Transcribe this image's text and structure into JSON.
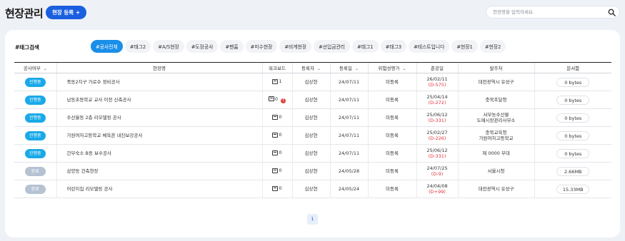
{
  "header": {
    "title": "현장관리",
    "register_label": "현장 등록 +",
    "search_placeholder": "현장명을 입력하세요."
  },
  "tags": {
    "label": "#태그검색",
    "items": [
      "#공사전체",
      "#태그2",
      "#A/S현장",
      "#도장공사",
      "#팬흄",
      "#미수현장",
      "#비계현장",
      "#선입금관리",
      "#태그1",
      "#태그3",
      "#테스트입니다",
      "#현장1",
      "#현장2"
    ],
    "active_index": 0
  },
  "table": {
    "headers": [
      "공사여부",
      "현장명",
      "워크보드",
      "등록자",
      "등록일",
      "위험성평가",
      "준공일",
      "발주처",
      "문서함"
    ],
    "rows": [
      {
        "status": "진행중",
        "status_type": "ongoing",
        "name": "죽동2지구 가로수 정비공사",
        "workboard": "1",
        "alert": "",
        "registrant": "김상현",
        "reg_date": "24/07/11",
        "risk": "미등록",
        "completion": "26/02/11",
        "dday": "(D-575)",
        "client": "대전광역시 유성구",
        "docs": "0 bytes"
      },
      {
        "status": "진행중",
        "status_type": "ongoing",
        "name": "남동초등학교 교사 이전 신축공사",
        "workboard": "0",
        "alert": "!",
        "registrant": "김상현",
        "reg_date": "24/07/11",
        "risk": "미등록",
        "completion": "25/04/14",
        "dday": "(D-272)",
        "client": "충북조달청",
        "docs": "0 bytes"
      },
      {
        "status": "진행중",
        "status_type": "ongoing",
        "name": "수산율동 2층 리모델링 공사",
        "workboard": "0",
        "alert": "",
        "registrant": "김상현",
        "reg_date": "24/07/11",
        "risk": "미등록",
        "completion": "25/06/12",
        "dday": "(D-331)",
        "client": "서부농수산물\n도매시장관리사무소",
        "docs": "0 bytes"
      },
      {
        "status": "진행중",
        "status_type": "ongoing",
        "name": "가원여자고등학교 체육관 내진보강공사",
        "workboard": "0",
        "alert": "",
        "registrant": "김상현",
        "reg_date": "24/07/11",
        "risk": "미등록",
        "completion": "25/02/27",
        "dday": "(D-226)",
        "client": "충북교육청\n가원여자고등학교",
        "docs": "0 bytes"
      },
      {
        "status": "진행중",
        "status_type": "ongoing",
        "name": "간부숙소 B동 보수공사",
        "workboard": "0",
        "alert": "",
        "registrant": "김상현",
        "reg_date": "24/07/11",
        "risk": "미등록",
        "completion": "25/06/12",
        "dday": "(D-331)",
        "client": "제 0000 부대",
        "docs": "0 bytes"
      },
      {
        "status": "완료",
        "status_type": "done",
        "name": "삼양동 건축현장",
        "workboard": "0",
        "alert": "",
        "registrant": "김상현",
        "reg_date": "24/05/28",
        "risk": "미등록",
        "completion": "24/07/25",
        "dday": "(D-9)",
        "client": "서울시청",
        "docs": "2.66MB"
      },
      {
        "status": "완료",
        "status_type": "done",
        "name": "어린이집 리모델링 공사",
        "workboard": "0",
        "alert": "",
        "registrant": "김상현",
        "reg_date": "24/05/24",
        "risk": "미등록",
        "completion": "24/04/08",
        "dday": "(D+99)",
        "client": "대전광역시 유성구",
        "docs": "15.33MB"
      }
    ]
  },
  "pagination": {
    "current": "1"
  }
}
